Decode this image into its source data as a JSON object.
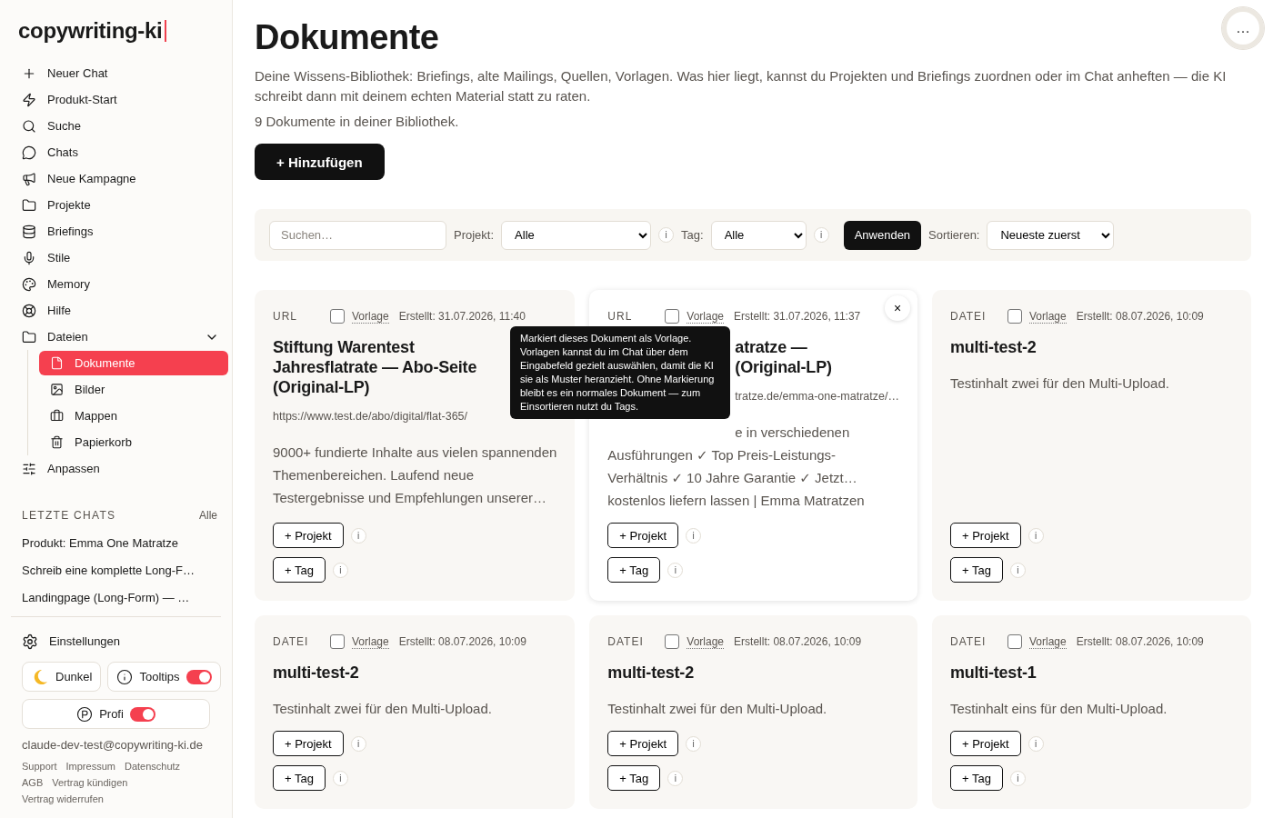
{
  "sidebar": {
    "logo": "copywriting-ki",
    "nav": [
      {
        "label": "Neuer Chat"
      },
      {
        "label": "Produkt-Start"
      },
      {
        "label": "Suche"
      },
      {
        "label": "Chats"
      },
      {
        "label": "Neue Kampagne"
      },
      {
        "label": "Projekte"
      },
      {
        "label": "Briefings"
      },
      {
        "label": "Stile"
      },
      {
        "label": "Memory"
      },
      {
        "label": "Hilfe"
      },
      {
        "label": "Dateien",
        "expanded": true,
        "children": [
          {
            "label": "Dokumente",
            "selected": true
          },
          {
            "label": "Bilder",
            "selected": false
          },
          {
            "label": "Mappen",
            "selected": false
          },
          {
            "label": "Papierkorb",
            "selected": false
          }
        ]
      },
      {
        "label": "Anpassen"
      }
    ],
    "recent": {
      "heading": "LETZTE CHATS",
      "all_link": "Alle",
      "items": [
        "Produkt: Emma One Matratze",
        "Schreib eine komplette Long-F…",
        "Landingpage (Long-Form) — …"
      ]
    },
    "settings": "Einstellungen",
    "toggles": [
      {
        "kind": "theme",
        "label": "Dunkel"
      },
      {
        "kind": "switch",
        "label": "Tooltips",
        "on": true
      },
      {
        "kind": "switch",
        "label": "Profi",
        "on": true
      }
    ],
    "email": "claude-dev-test@copywriting-ki.de",
    "footer_links": [
      "Support",
      "Impressum",
      "Datenschutz",
      "AGB",
      "Vertrag kündigen",
      "Vertrag widerrufen"
    ]
  },
  "main": {
    "title": "Dokumente",
    "more_button": "…",
    "description": "Deine Wissens-Bibliothek: Briefings, alte Mailings, Quellen, Vorlagen. Was hier liegt, kannst du Projekten und Briefings zuordnen oder im Chat anheften — die KI schreibt dann mit deinem echten Material statt zu raten.",
    "count": "9 Dokumente in deiner Bibliothek.",
    "add_button": "+ Hinzufügen",
    "filters": {
      "search": {
        "placeholder": "Suchen…"
      },
      "project_label": "Projekt:",
      "project_value": "Alle",
      "project_info": "i",
      "tag_label": "Tag:",
      "tag_value": "Alle",
      "tag_info": "i",
      "apply": "Anwenden",
      "sort_label": "Sortieren:",
      "sort_value": "Neueste zuerst"
    },
    "tooltip": "Markiert dieses Dokument als Vorlage. Vorlagen kannst du im Chat über dem Eingabefeld gezielt auswählen, damit die KI sie als Muster heranzieht. Ohne Markierung bleibt es ein normales Dokument — zum Einsortieren nutzt du Tags.",
    "cards": [
      {
        "type": "URL",
        "template": false,
        "template_label": "Vorlage",
        "created": "Erstellt: 31.07.2026, 11:40",
        "hovered": false,
        "title_lines": [
          "Stiftung Warentest",
          "Jahresflatrate — Abo-Seite",
          "(Original-LP)"
        ],
        "url": "https://www.test.de/abo/digital/flat-365/",
        "description_lines": [
          "9000+ fundierte Inhalte aus vielen spannenden",
          "Themenbereichen. Laufend neue",
          "Testergebnisse und Empfehlungen unserer…"
        ],
        "project_button": "+ Projekt",
        "project_info": "i",
        "tag_button": "+ Tag",
        "tag_info": "i"
      },
      {
        "type": "URL",
        "template": false,
        "template_label": "Vorlage",
        "created": "Erstellt: 31.07.2026, 11:37",
        "hovered": true,
        "close": "×",
        "covered": true,
        "title_lines": [
          "atratze —",
          "(Original-LP)"
        ],
        "url": "tratze.de/emma-one-matratze/…",
        "description_lines": [
          "e in verschiedenen",
          "Ausführungen ✓ Top Preis-Leistungs-",
          "Verhältnis ✓ 10 Jahre Garantie ✓ Jetzt…",
          "kostenlos liefern lassen | Emma Matratzen"
        ],
        "project_button": "+ Projekt",
        "project_info": "i",
        "tag_button": "+ Tag",
        "tag_info": "i"
      },
      {
        "type": "DATEI",
        "template": false,
        "template_label": "Vorlage",
        "created": "Erstellt: 08.07.2026, 10:09",
        "hovered": false,
        "covered": false,
        "title_lines": [
          "multi-test-2"
        ],
        "description_lines": [
          "Testinhalt zwei für den Multi-Upload."
        ],
        "project_button": "+ Projekt",
        "project_info": "i",
        "tag_button": "+ Tag",
        "tag_info": "i"
      },
      {
        "type": "DATEI",
        "template": false,
        "template_label": "Vorlage",
        "created": "Erstellt: 08.07.2026, 10:09",
        "hovered": false,
        "covered": false,
        "title_lines": [
          "multi-test-2"
        ],
        "description_lines": [
          "Testinhalt zwei für den Multi-Upload."
        ],
        "project_button": "+ Projekt",
        "project_info": "i",
        "tag_button": "+ Tag",
        "tag_info": "i"
      },
      {
        "type": "DATEI",
        "template": false,
        "template_label": "Vorlage",
        "created": "Erstellt: 08.07.2026, 10:09",
        "hovered": false,
        "covered": false,
        "title_lines": [
          "multi-test-2"
        ],
        "description_lines": [
          "Testinhalt zwei für den Multi-Upload."
        ],
        "project_button": "+ Projekt",
        "project_info": "i",
        "tag_button": "+ Tag",
        "tag_info": "i"
      },
      {
        "type": "DATEI",
        "template": false,
        "template_label": "Vorlage",
        "created": "Erstellt: 08.07.2026, 10:09",
        "hovered": false,
        "title_lines": [
          "multi-test-1"
        ],
        "description_lines": [
          "Testinhalt eins für den Multi-Upload."
        ],
        "project_button": "+ Projekt",
        "project_info": "i",
        "tag_button": "+ Tag",
        "tag_info": "i"
      }
    ]
  }
}
